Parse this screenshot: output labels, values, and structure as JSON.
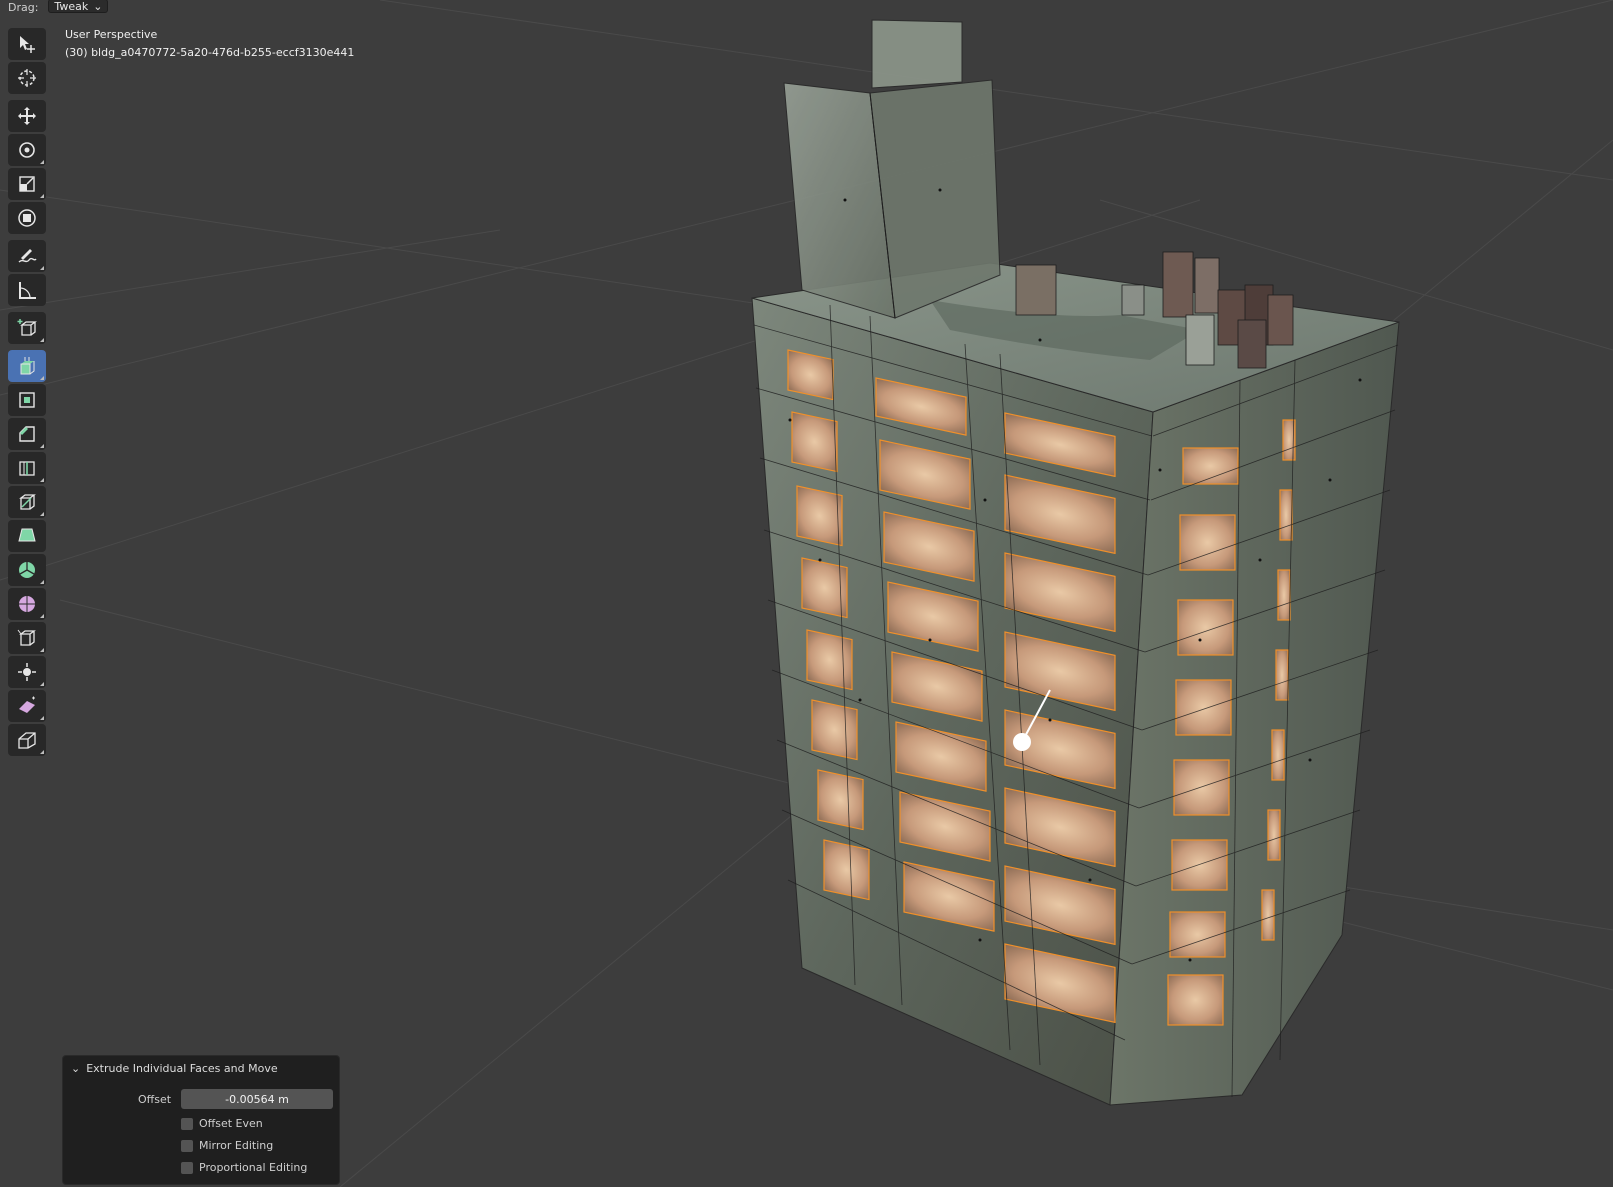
{
  "header": {
    "drag_label": "Drag:",
    "drag_value": "Tweak"
  },
  "viewport": {
    "view_name": "User Perspective",
    "object_name": "(30) bldg_a0470772-5a20-476d-b255-eccf3130e441"
  },
  "toolbar": {
    "tools": [
      {
        "icon": "select-box-icon"
      },
      {
        "icon": "cursor-icon"
      },
      {
        "icon": "move-icon"
      },
      {
        "icon": "rotate-icon"
      },
      {
        "icon": "scale-icon"
      },
      {
        "icon": "transform-icon"
      },
      {
        "icon": "annotate-icon"
      },
      {
        "icon": "measure-icon"
      },
      {
        "icon": "add-cube-icon"
      },
      {
        "icon": "extrude-region-icon",
        "active": true
      },
      {
        "icon": "inset-faces-icon"
      },
      {
        "icon": "bevel-icon"
      },
      {
        "icon": "loop-cut-icon"
      },
      {
        "icon": "knife-icon"
      },
      {
        "icon": "poly-build-icon"
      },
      {
        "icon": "spin-icon"
      },
      {
        "icon": "smooth-icon"
      },
      {
        "icon": "edge-slide-icon"
      },
      {
        "icon": "shrink-fatten-icon"
      },
      {
        "icon": "shear-icon"
      },
      {
        "icon": "rip-region-icon"
      }
    ]
  },
  "operator_panel": {
    "title": "Extrude Individual Faces and Move",
    "offset_label": "Offset",
    "offset_value": "-0.00564 m",
    "offset_even": "Offset Even",
    "mirror_editing": "Mirror Editing",
    "proportional_editing": "Proportional Editing"
  },
  "colors": {
    "viewport_bg": "#3d3d3d",
    "active_tool": "#4a72b3",
    "selection_orange": "#f0902a",
    "panel_bg": "#1f1f1f"
  }
}
